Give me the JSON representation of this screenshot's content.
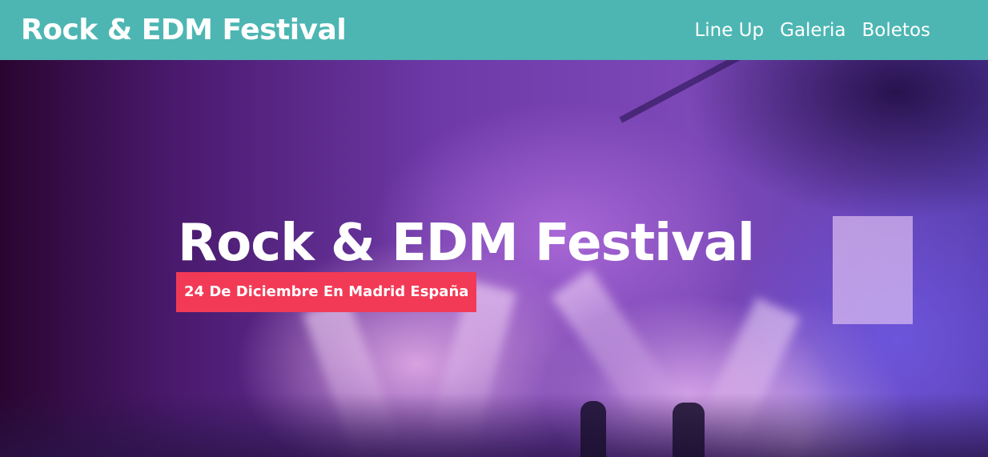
{
  "header": {
    "brand": "Rock & EDM Festival",
    "nav": [
      {
        "label": "Line Up"
      },
      {
        "label": "Galeria"
      },
      {
        "label": "Boletos"
      }
    ]
  },
  "hero": {
    "title": "Rock & EDM Festival",
    "subtitle": "24 De Diciembre En Madrid España"
  },
  "colors": {
    "header_bg": "#4db6b3",
    "subtitle_bg": "#f23a56",
    "text": "#ffffff"
  }
}
